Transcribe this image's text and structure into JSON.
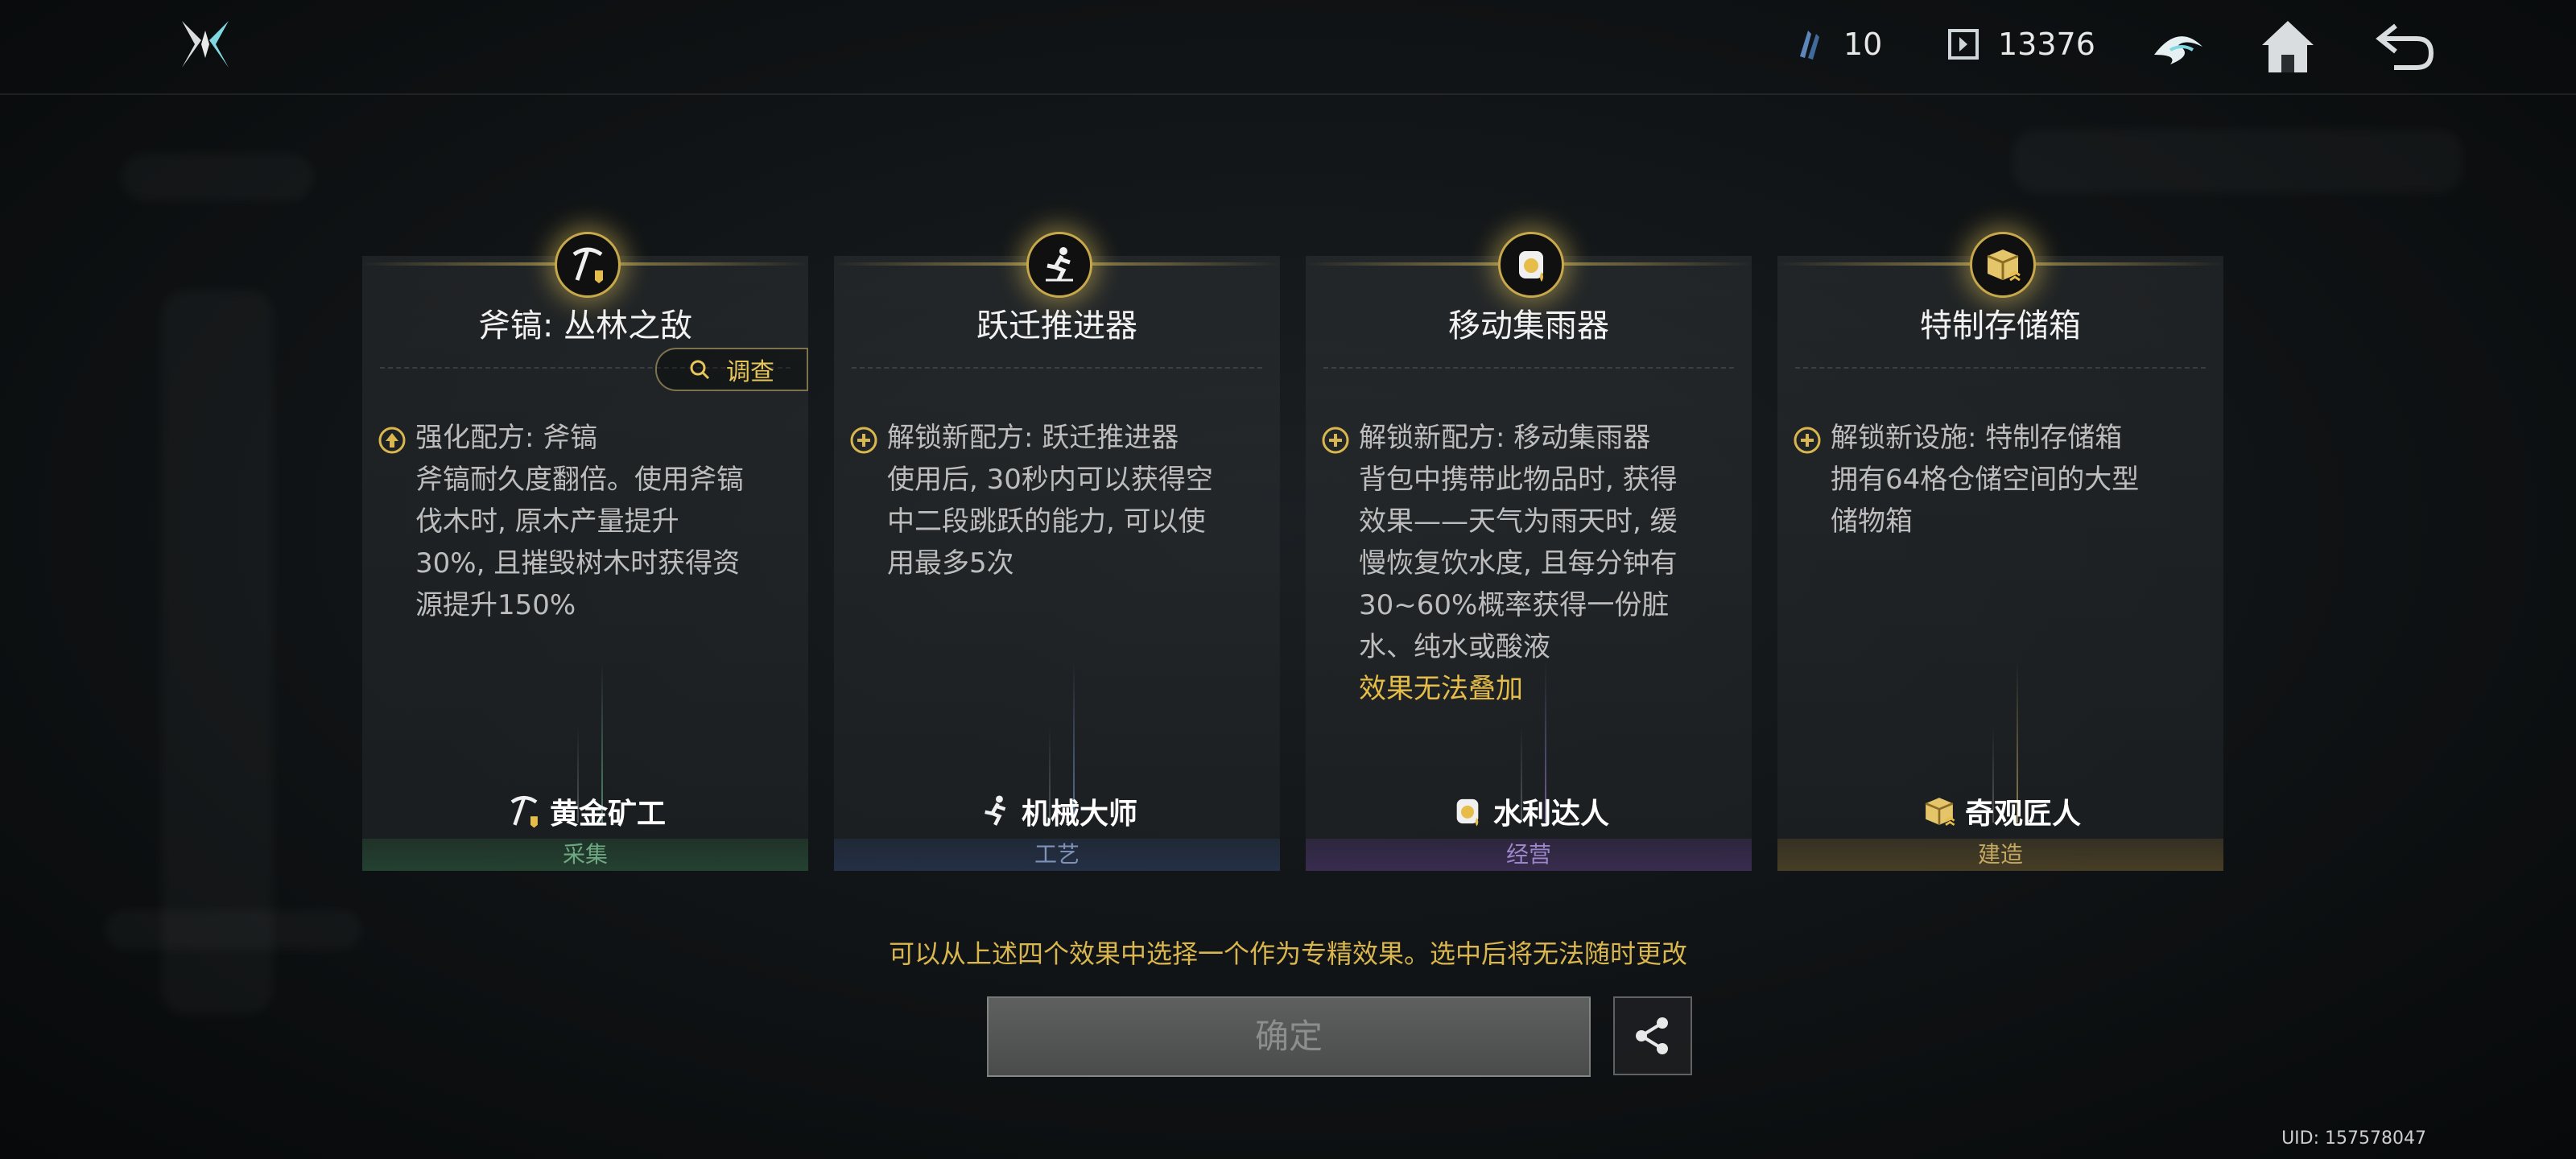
{
  "header": {
    "resource_1": {
      "icon": "crystal-shard-icon",
      "value": "10"
    },
    "resource_2": {
      "icon": "frame-token-icon",
      "value": "13376"
    }
  },
  "cards": [
    {
      "title": "斧镐: 丛林之敌",
      "badge_icon": "pickaxe-icon",
      "investigate_label": "调查",
      "effect_lines": [
        "强化配方: 斧镐",
        "斧镐耐久度翻倍。使用斧镐",
        "伐木时, 原木产量提升",
        "30%, 且摧毁树木时获得资",
        "源提升150%"
      ],
      "effect_icon": "upgrade-arrow-icon",
      "role": "黄金矿工",
      "category": "采集"
    },
    {
      "title": "跃迁推进器",
      "badge_icon": "jumping-figure-icon",
      "effect_lines": [
        "解锁新配方: 跃迁推进器",
        "使用后, 30秒内可以获得空",
        "中二段跳跃的能力, 可以使",
        "用最多5次"
      ],
      "effect_icon": "plus-circle-icon",
      "role": "机械大师",
      "category": "工艺"
    },
    {
      "title": "移动集雨器",
      "badge_icon": "rain-collector-icon",
      "effect_lines": [
        "解锁新配方: 移动集雨器",
        "背包中携带此物品时, 获得",
        "效果——天气为雨天时, 缓",
        "慢恢复饮水度, 且每分钟有",
        "30~60%概率获得一份脏",
        "水、纯水或酸液"
      ],
      "effect_note": "效果无法叠加",
      "effect_icon": "plus-circle-icon",
      "role": "水利达人",
      "category": "经营"
    },
    {
      "title": "特制存储箱",
      "badge_icon": "storage-box-icon",
      "effect_lines": [
        "解锁新设施: 特制存储箱",
        "拥有64格仓储空间的大型",
        "储物箱"
      ],
      "effect_icon": "plus-circle-icon",
      "role": "奇观匠人",
      "category": "建造"
    }
  ],
  "hint": "可以从上述四个效果中选择一个作为专精效果。选中后将无法随时更改",
  "confirm_label": "确定",
  "uid": "UID: 157578047",
  "colors": {
    "accent_gold": "#e5bd48",
    "collect": "#6ea882",
    "craft": "#7e92b8",
    "manage": "#9b86c9",
    "build": "#c3a862"
  }
}
